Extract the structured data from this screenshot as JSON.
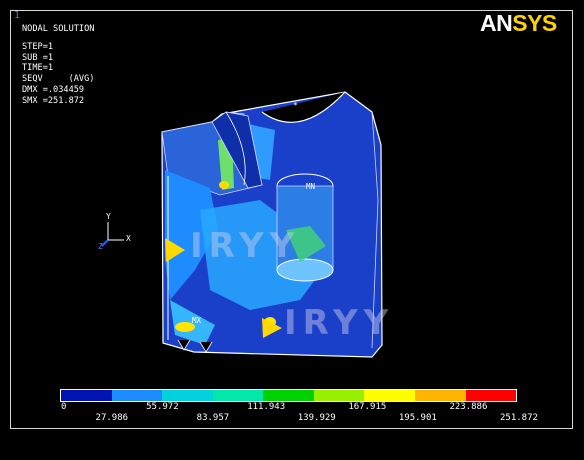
{
  "window": {
    "number": "1"
  },
  "brand": {
    "an": "AN",
    "sys": "SYS"
  },
  "legend": {
    "title": "NODAL SOLUTION",
    "step": "STEP=1",
    "sub": "SUB =1",
    "time": "TIME=1",
    "seqv": "SEQV     (AVG)",
    "dmx": "DMX =.034459",
    "smx": "SMX =251.872"
  },
  "triad": {
    "y": "Y",
    "x": "X",
    "z": "Z"
  },
  "markers": {
    "mn": "MN",
    "mx": "MX"
  },
  "watermark": {
    "text": "IRYY"
  },
  "colorbar": {
    "colors": [
      "#0014b4",
      "#1e8cff",
      "#00d2dc",
      "#00e8aa",
      "#00d200",
      "#96f000",
      "#ffff00",
      "#ffb400",
      "#ff0000"
    ],
    "ticks_top": [
      "0",
      "55.972",
      "111.943",
      "167.915",
      "223.886"
    ],
    "ticks_bottom": [
      "27.986",
      "83.957",
      "139.929",
      "195.901",
      "251.872"
    ]
  },
  "colors": {
    "frame": "#d8d8d8",
    "window_number": "#4f79ff",
    "brand_sys": "#ffd200"
  }
}
